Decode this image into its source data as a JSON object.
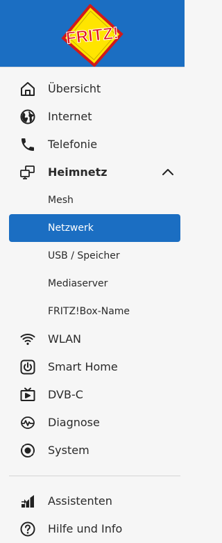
{
  "brand": {
    "logo_text": "FRITZ!",
    "header_color": "#1b6ec2",
    "accent": "#1b6ec2"
  },
  "nav": {
    "items": [
      {
        "label": "Übersicht",
        "icon": "home-icon"
      },
      {
        "label": "Internet",
        "icon": "globe-icon"
      },
      {
        "label": "Telefonie",
        "icon": "phone-icon"
      },
      {
        "label": "Heimnetz",
        "icon": "network-icon",
        "expanded": true
      }
    ],
    "heimnetz_sub": [
      {
        "label": "Mesh"
      },
      {
        "label": "Netzwerk",
        "active": true
      },
      {
        "label": "USB / Speicher"
      },
      {
        "label": "Mediaserver"
      },
      {
        "label": "FRITZ!Box-Name"
      }
    ],
    "more_items": [
      {
        "label": "WLAN",
        "icon": "wifi-icon"
      },
      {
        "label": "Smart Home",
        "icon": "power-icon"
      },
      {
        "label": "DVB-C",
        "icon": "tv-icon"
      },
      {
        "label": "Diagnose",
        "icon": "diagnose-icon"
      },
      {
        "label": "System",
        "icon": "system-icon"
      }
    ],
    "bottom_items": [
      {
        "label": "Assistenten",
        "icon": "assistant-icon"
      },
      {
        "label": "Hilfe und Info",
        "icon": "help-icon"
      }
    ]
  }
}
